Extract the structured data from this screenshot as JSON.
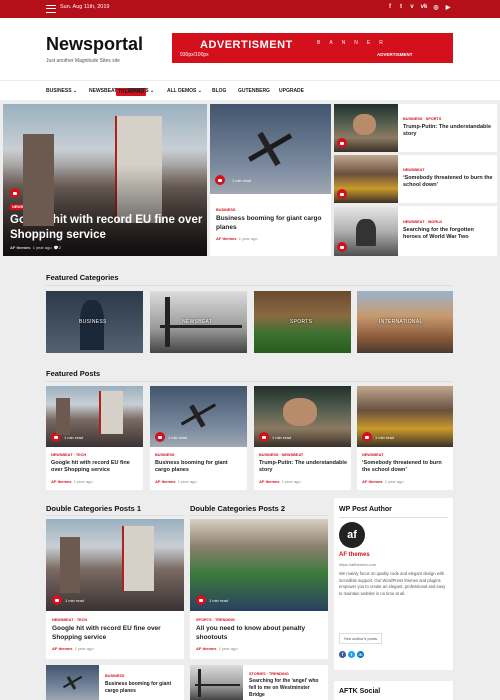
{
  "topbar": {
    "date": "Sun. Aug 11th, 2019",
    "social_icons": [
      "facebook-icon",
      "twitter-icon",
      "vimeo-icon",
      "vk-icon",
      "instagram-icon",
      "youtube-icon"
    ],
    "social_glyphs": [
      "f",
      "t",
      "v",
      "vk",
      "◎",
      "▶"
    ],
    "bg": "#b5101a"
  },
  "header": {
    "logo": "Newsportal",
    "tagline": "Just another Magnitude Sites site"
  },
  "ad": {
    "headline": "ADVERTISMENT",
    "size": "930px/100px",
    "banner": "BANNER",
    "small": "ADVERTISMENT",
    "bg": "#d3101b"
  },
  "nav": {
    "items": [
      "BUSINESS ⌄",
      "NEWSBEAT",
      "SPORTS ⌄",
      "ALL DEMOS ⌄",
      "BLOG",
      "GUTENBERG",
      "UPGRADE"
    ],
    "hot_badge": "TRENDING"
  },
  "hero": {
    "main": {
      "tags": [
        "NEWSBEAT",
        "TECH"
      ],
      "minread": "1 min read",
      "title": "Google hit with record EU fine over Shopping service",
      "author": "AF themes",
      "time": "1 year ago",
      "comments": "2"
    },
    "middle": {
      "minread": "1 min read",
      "cats": "BUSINESS",
      "title": "Business booming for giant cargo planes",
      "author": "AF themes",
      "time": "1 year ago"
    },
    "side": [
      {
        "cats": "BUSINESS · SPORTS",
        "title": "Trump-Putin: The understandable story"
      },
      {
        "cats": "NEWSBEAT",
        "title": "‘Somebody threatened to burn the school down’"
      },
      {
        "cats": "NEWSBEAT · WORLD",
        "title": "Searching for the forgotten heroes of World War Two"
      }
    ]
  },
  "featured_categories": {
    "title": "Featured Categories",
    "items": [
      "BUSINESS",
      "NEWSBEAT",
      "SPORTS",
      "INTERNATIONAL"
    ]
  },
  "featured_posts": {
    "title": "Featured Posts",
    "items": [
      {
        "cats": "NEWSBEAT · TECH",
        "minread": "1 min read",
        "title": "Google hit with record EU fine over Shopping service",
        "author": "AF themes",
        "time": "1 year ago"
      },
      {
        "cats": "BUSINESS",
        "minread": "1 min read",
        "title": "Business booming for giant cargo planes",
        "author": "AF themes",
        "time": "1 year ago"
      },
      {
        "cats": "BUSINESS · NEWSBEAT",
        "minread": "1 min read",
        "title": "Trump-Putin: The understandable story",
        "author": "AF themes",
        "time": "1 year ago"
      },
      {
        "cats": "NEWSBEAT",
        "minread": "1 min read",
        "title": "‘Somebody threatened to burn the school down’",
        "author": "AF themes",
        "time": "1 year ago"
      }
    ]
  },
  "double1": {
    "title": "Double Categories Posts 1",
    "main": {
      "tags": "NEWSBEAT · TECH",
      "minread": "1 min read",
      "title": "Google hit with record EU fine over Shopping service",
      "author": "AF themes",
      "time": "1 year ago"
    },
    "small": {
      "cats": "BUSINESS",
      "title": "Business booming for giant cargo planes"
    }
  },
  "double2": {
    "title": "Double Categories Posts 2",
    "main": {
      "tags": "SPORTS · TRENDING",
      "minread": "1 min read",
      "title": "All you need to know about penalty shootouts",
      "author": "AF themes",
      "time": "1 year ago"
    },
    "small": {
      "cats": "STORIES · TRENDING",
      "title": "Searching for the ‘angel’ who fell to me on Westminster Bridge"
    }
  },
  "author_widget": {
    "title": "WP Post Author",
    "name": "AF themes",
    "url": "https://afthemes.com",
    "bio": "We mainly focus on quality code and elegant design with incredible support. Our WordPress themes and plugins empower you to create an elegant, professional and easy to maintain website in no time at all.",
    "button": "See author's posts",
    "social": [
      "f",
      "t",
      "in"
    ]
  },
  "aftk": {
    "title": "AFTK Social"
  }
}
